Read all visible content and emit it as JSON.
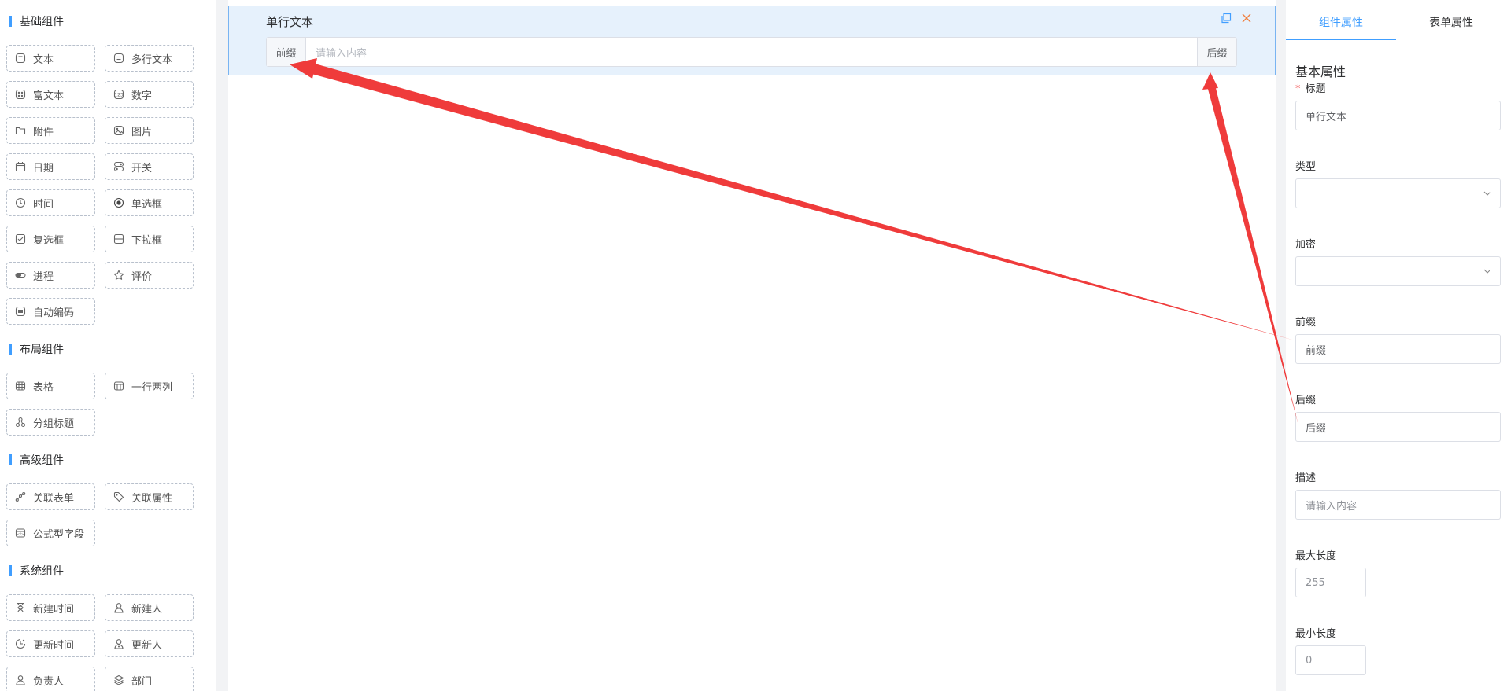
{
  "palette": {
    "sections": [
      {
        "title": "基础组件",
        "items": [
          {
            "label": "文本",
            "icon": "text-icon"
          },
          {
            "label": "多行文本",
            "icon": "multiline-text-icon"
          },
          {
            "label": "富文本",
            "icon": "rich-text-icon"
          },
          {
            "label": "数字",
            "icon": "number-icon"
          },
          {
            "label": "附件",
            "icon": "folder-icon"
          },
          {
            "label": "图片",
            "icon": "image-icon"
          },
          {
            "label": "日期",
            "icon": "calendar-icon"
          },
          {
            "label": "开关",
            "icon": "switch-icon"
          },
          {
            "label": "时间",
            "icon": "clock-icon"
          },
          {
            "label": "单选框",
            "icon": "radio-icon"
          },
          {
            "label": "复选框",
            "icon": "checkbox-icon"
          },
          {
            "label": "下拉框",
            "icon": "select-icon"
          },
          {
            "label": "进程",
            "icon": "progress-icon"
          },
          {
            "label": "评价",
            "icon": "star-icon"
          },
          {
            "label": "自动编码",
            "icon": "auto-code-icon"
          }
        ]
      },
      {
        "title": "布局组件",
        "items": [
          {
            "label": "表格",
            "icon": "table-icon"
          },
          {
            "label": "一行两列",
            "icon": "two-column-icon"
          },
          {
            "label": "分组标题",
            "icon": "group-title-icon"
          }
        ]
      },
      {
        "title": "高级组件",
        "items": [
          {
            "label": "关联表单",
            "icon": "link-form-icon"
          },
          {
            "label": "关联属性",
            "icon": "tag-icon"
          },
          {
            "label": "公式型字段",
            "icon": "formula-icon"
          }
        ]
      },
      {
        "title": "系统组件",
        "items": [
          {
            "label": "新建时间",
            "icon": "hourglass-icon"
          },
          {
            "label": "新建人",
            "icon": "user-icon"
          },
          {
            "label": "更新时间",
            "icon": "clock-refresh-icon"
          },
          {
            "label": "更新人",
            "icon": "user-update-icon"
          },
          {
            "label": "负责人",
            "icon": "owner-icon"
          },
          {
            "label": "部门",
            "icon": "layers-icon"
          }
        ]
      }
    ]
  },
  "canvas": {
    "field": {
      "label": "单行文本",
      "prefix": "前缀",
      "placeholder": "请输入内容",
      "suffix": "后缀"
    },
    "actions": {
      "copy_icon": "copy-icon",
      "close_icon": "close-icon"
    }
  },
  "props": {
    "tabs": [
      "组件属性",
      "表单属性"
    ],
    "active_tab": "组件属性",
    "section_title": "基本属性",
    "required_mark": "*",
    "fields": {
      "title_label": "标题",
      "title_value": "单行文本",
      "type_label": "类型",
      "encrypt_label": "加密",
      "prefix_label": "前缀",
      "prefix_value": "前缀",
      "suffix_label": "后缀",
      "suffix_value": "后缀",
      "desc_label": "描述",
      "desc_placeholder": "请输入内容",
      "max_label": "最大长度",
      "max_value": "255",
      "min_label": "最小长度",
      "min_value": "0"
    }
  },
  "colors": {
    "accent": "#409eff",
    "selected_card_bg": "#e6f1fc",
    "annotation_arrow": "#ef3b3b",
    "required": "#f56c6c"
  }
}
